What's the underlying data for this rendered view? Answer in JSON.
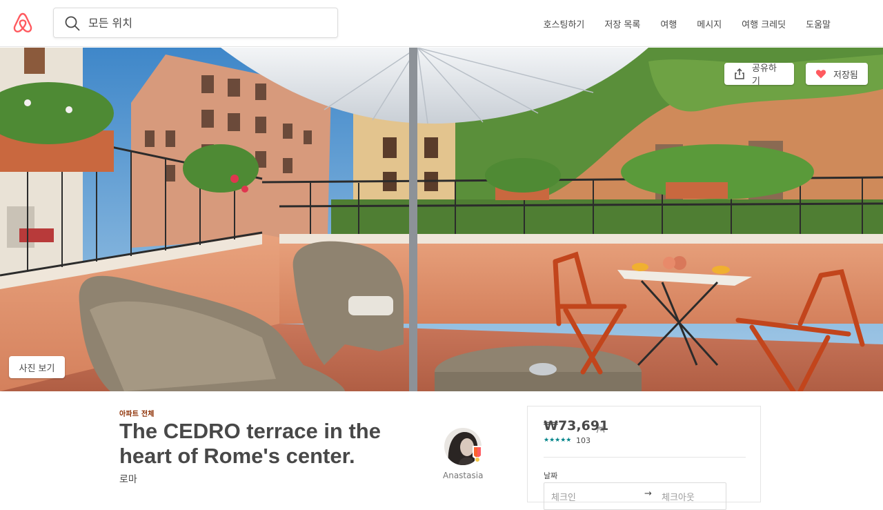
{
  "header": {
    "logo": "airbnb-logo",
    "search": {
      "placeholder": "모든 위치",
      "icon": "search-icon"
    },
    "nav": [
      "호스팅하기",
      "저장 목록",
      "여행",
      "메시지",
      "여행 크레딧",
      "도움말"
    ]
  },
  "hero": {
    "share_label": "공유하기",
    "save_label": "저장됨",
    "photos_label": "사진 보기",
    "share_icon": "share-icon",
    "save_icon": "heart-icon"
  },
  "listing": {
    "room_type": "아파트 전체",
    "title": "The CEDRO terrace in the heart of Rome's center.",
    "city": "로마",
    "host_name": "Anastasia"
  },
  "booking": {
    "price": "₩73,691",
    "per_night": "/박",
    "stars": "★★★★★",
    "review_count": "103",
    "dates_label": "날짜",
    "check_in": "체크인",
    "check_out": "체크아웃",
    "arrow": "→"
  },
  "colors": {
    "brand": "#ff5a5f",
    "room_type": "#8c2d00",
    "stars": "#008489",
    "text": "#484848"
  }
}
